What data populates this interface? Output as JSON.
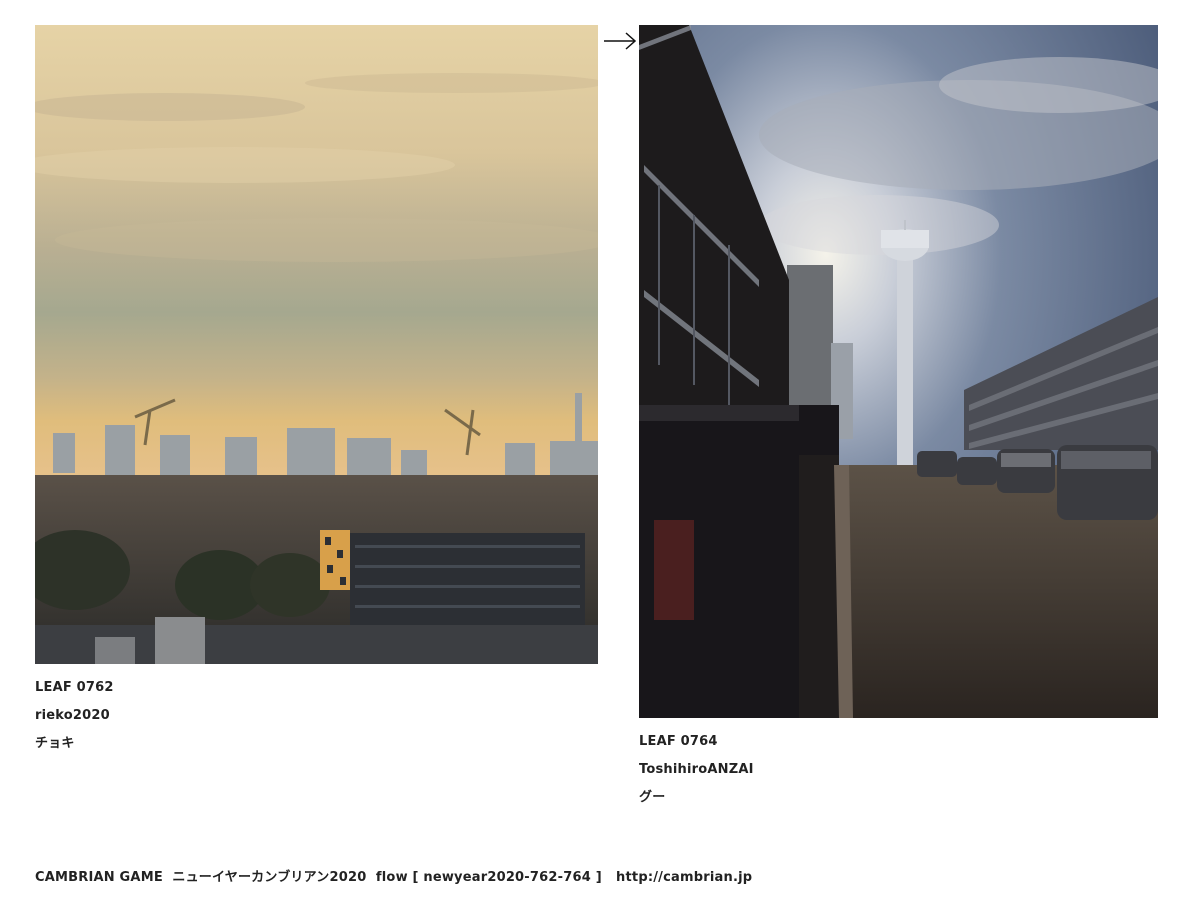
{
  "leaves": [
    {
      "id_label": "LEAF 0762",
      "author": "rieko2020",
      "move": "チョキ"
    },
    {
      "id_label": "LEAF 0764",
      "author": "ToshihiroANZAI",
      "move": "グー"
    }
  ],
  "flow_arrow_icon": "right-arrow",
  "footer": {
    "game_name": "CAMBRIAN GAME",
    "event_name": "ニューイヤーカンブリアン2020",
    "flow_label": "flow [ newyear2020-762-764 ]",
    "site_url": "http://cambrian.jp"
  }
}
